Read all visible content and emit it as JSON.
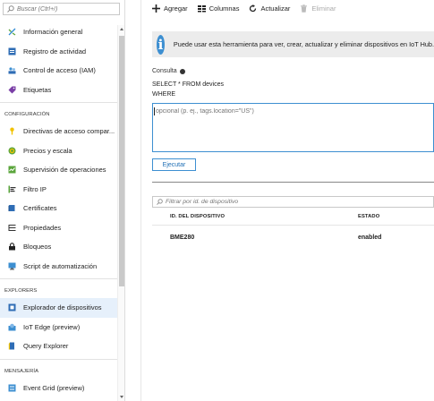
{
  "search": {
    "placeholder": "Buscar (Ctrl+/)"
  },
  "sidebar": {
    "items_top": [
      {
        "label": "Información general",
        "icon": "overview-icon"
      },
      {
        "label": "Registro de actividad",
        "icon": "activity-log-icon"
      },
      {
        "label": "Control de acceso (IAM)",
        "icon": "iam-icon"
      },
      {
        "label": "Etiquetas",
        "icon": "tag-icon"
      }
    ],
    "section_config": "CONFIGURACIÓN",
    "items_config": [
      {
        "label": "Directivas de acceso compar...",
        "icon": "key-icon"
      },
      {
        "label": "Precios y escala",
        "icon": "pricing-icon"
      },
      {
        "label": "Supervisión de operaciones",
        "icon": "monitoring-icon"
      },
      {
        "label": "Filtro IP",
        "icon": "ip-filter-icon"
      },
      {
        "label": "Certificates",
        "icon": "certificate-icon"
      },
      {
        "label": "Propiedades",
        "icon": "properties-icon"
      },
      {
        "label": "Bloqueos",
        "icon": "lock-icon"
      },
      {
        "label": "Script de automatización",
        "icon": "automation-script-icon"
      }
    ],
    "section_explorers": "EXPLORERS",
    "items_explorers": [
      {
        "label": "Explorador de dispositivos",
        "icon": "device-explorer-icon",
        "active": true
      },
      {
        "label": "IoT Edge (preview)",
        "icon": "iot-edge-icon"
      },
      {
        "label": "Query Explorer",
        "icon": "query-explorer-icon"
      }
    ],
    "section_messaging": "MENSAJERÍA",
    "items_messaging": [
      {
        "label": "Event Grid (preview)",
        "icon": "event-grid-icon"
      }
    ]
  },
  "toolbar": {
    "add": "Agregar",
    "columns": "Columnas",
    "refresh": "Actualizar",
    "delete": "Eliminar"
  },
  "banner": {
    "text": "Puede usar esta herramienta para ver, crear, actualizar y eliminar dispositivos en IoT Hub."
  },
  "query": {
    "label": "Consulta",
    "select": "SELECT * FROM devices",
    "where": "WHERE",
    "where_placeholder": "opcional (p. ej., tags.location=\"US\")",
    "execute": "Ejecutar"
  },
  "filter": {
    "placeholder": "Filtrar por id. de dispositivo"
  },
  "table": {
    "headers": [
      "ID. DEL DISPOSITIVO",
      "ESTADO"
    ],
    "rows": [
      [
        "BME280",
        "enabled"
      ]
    ]
  },
  "colors": {
    "accent": "#3d8fd1",
    "active_bg": "#e6f0fb",
    "banner_bg": "#ececec"
  }
}
